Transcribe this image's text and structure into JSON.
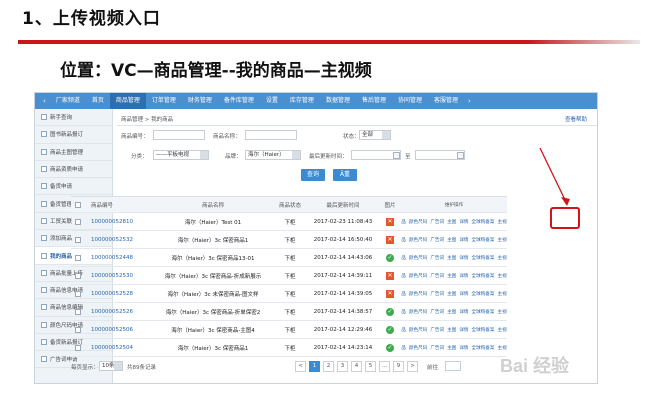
{
  "slide": {
    "title": "1、上传视频入口",
    "subtitle": "位置：VC—商品管理--我的商品—主视频"
  },
  "topnav": {
    "items": [
      "厂家频道",
      "首页",
      "商品管理",
      "订单管理",
      "财务管理",
      "备件库管理",
      "设置",
      "库存管理",
      "数据管理",
      "售后管理",
      "协同管理",
      "客服管理"
    ],
    "active": "商品管理"
  },
  "sidebar": {
    "items": [
      "新手查询",
      "图书新品报订",
      "商品主图管理",
      "商品资质申请",
      "备货申请",
      "备货管理",
      "工贸关联",
      "添加商品",
      "我的商品",
      "商品批量上传",
      "商品信息申请",
      "商品信息编辑",
      "颜色尺码申请",
      "备货新品报订",
      "广告词申请"
    ],
    "active": "我的商品"
  },
  "main": {
    "breadcrumb": "商品管理 > 我的商品",
    "help_link": "查看帮助",
    "filters": {
      "sku_label": "商品编号：",
      "name_label": "商品名称：",
      "state_label": "状态：",
      "state_value": "全部",
      "category_label": "分类：",
      "category_value": "——平板电视",
      "brand_label": "品牌：",
      "brand_value": "海尔（Haier）",
      "time_label": "最后更新时间：",
      "time_sep": "至"
    },
    "search_button": "查询",
    "reset_button": "Ā重"
  },
  "table": {
    "headers": {
      "sku": "商品编号",
      "name": "商品名称",
      "status": "商品状态",
      "time": "最后更新时间",
      "image": "图片",
      "ops": "维护操作"
    },
    "rows": [
      {
        "sku": "100000052810",
        "name": "海尔（Haier）Test 01",
        "status": "下柜",
        "time": "2017-02-23 11:08:43",
        "img": "no"
      },
      {
        "sku": "100000052532",
        "name": "海尔（Haier）3c 保密商品1",
        "status": "下柜",
        "time": "2017-02-14 16:50:40",
        "img": "no"
      },
      {
        "sku": "100000052448",
        "name": "海尔（Haier）3c 保密商品13-01",
        "status": "下柜",
        "time": "2017-02-14 14:43:06",
        "img": "ok"
      },
      {
        "sku": "100000052530",
        "name": "海尔（Haier）3c 保密商品-折成新展示",
        "status": "下柜",
        "time": "2017-02-14 14:39:11",
        "img": "no"
      },
      {
        "sku": "100000052528",
        "name": "海尔（Haier）3c 未保密商品-图文样",
        "status": "下柜",
        "time": "2017-02-14 14:39:05",
        "img": "no"
      },
      {
        "sku": "100000052526",
        "name": "海尔（Haier）3c 保密商品-折单保密2",
        "status": "下柜",
        "time": "2017-02-14 14:38:57",
        "img": "ok"
      },
      {
        "sku": "100000052506",
        "name": "海尔（Haier）3c 保密商品-主图4",
        "status": "下柜",
        "time": "2017-02-14 12:29:46",
        "img": "ok"
      },
      {
        "sku": "100000052504",
        "name": "海尔（Haier）3c 保密商品1",
        "status": "下柜",
        "time": "2017-02-14 14:23:14",
        "img": "ok"
      }
    ],
    "ops": [
      "商品",
      "颜色尺码",
      "广告词",
      "主图",
      "详情",
      "全球购备案",
      "主视频"
    ]
  },
  "pager": {
    "per_page_label": "每页显示：",
    "per_page_value": "10条",
    "total": "共89条记录",
    "pages": [
      "1",
      "2",
      "3",
      "4",
      "5",
      "...",
      "9"
    ],
    "current": "1",
    "prev": "<",
    "next": ">",
    "goto_label": "前往"
  },
  "watermark": "Bai 经验",
  "colors": {
    "nav": "#4a8fcf",
    "accent_red": "#c8161d",
    "link": "#2a66ab"
  }
}
